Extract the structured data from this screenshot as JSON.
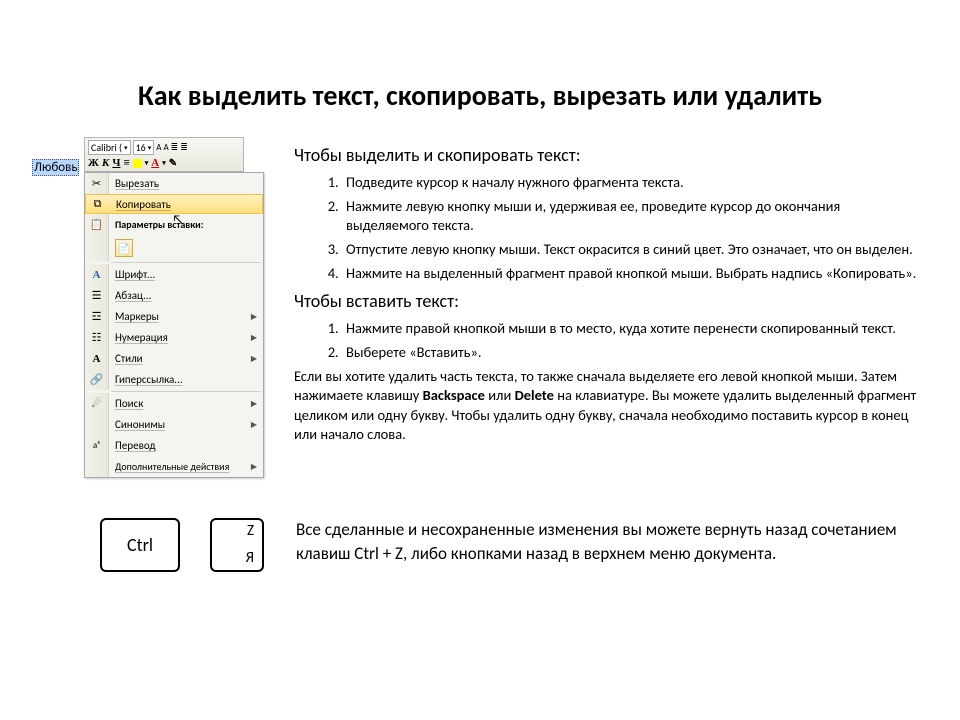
{
  "title": "Как выделить текст, скопировать, вырезать или удалить",
  "selected_word": "Любовь",
  "mini_toolbar": {
    "font_name": "Calibri (",
    "font_size": "16",
    "a_big": "A",
    "a_small": "A"
  },
  "context_menu": {
    "cut": "Вырезать",
    "copy": "Копировать",
    "paste_section": "Параметры вставки:",
    "font": "Шрифт...",
    "paragraph": "Абзац...",
    "markers": "Маркеры",
    "numbering": "Нумерация",
    "styles": "Стили",
    "hyperlink": "Гиперссылка...",
    "search": "Поиск",
    "synonyms": "Синонимы",
    "translate": "Перевод",
    "extra": "Дополнительные действия"
  },
  "section1": {
    "heading": "Чтобы выделить и скопировать текст:",
    "items": [
      "Подведите курсор к началу нужного фрагмента текста.",
      "Нажмите левую кнопку мыши и, удерживая ее, проведите курсор до окончания выделяемого текста.",
      "Отпустите левую кнопку мыши. Текст окрасится в синий цвет. Это означает, что он выделен.",
      "Нажмите на выделенный фрагмент правой кнопкой мыши. Выбрать надпись «Копировать»."
    ]
  },
  "section2": {
    "heading": "Чтобы вставить текст:",
    "items": [
      "Нажмите правой кнопкой мыши в то место, куда хотите перенести скопированный текст.",
      "Выберете «Вставить»."
    ]
  },
  "delete_para_1": "Если вы хотите удалить часть текста, то также сначала выделяете его левой кнопкой мыши. Затем нажимаете клавишу ",
  "delete_bold_1": "Backspace",
  "delete_mid": " или ",
  "delete_bold_2": "Delete",
  "delete_para_2": " на клавиатуре. Вы можете удалить выделенный фрагмент целиком или одну букву. Чтобы удалить одну букву, сначала необходимо поставить курсор в конец или начало слова.",
  "key_ctrl": "Ctrl",
  "key_z_top": "Z",
  "key_z_bot": "Я",
  "undo_text": "Все сделанные и несохраненные изменения вы можете вернуть назад сочетанием клавиш Ctrl + Z, либо кнопками назад в верхнем меню документа."
}
